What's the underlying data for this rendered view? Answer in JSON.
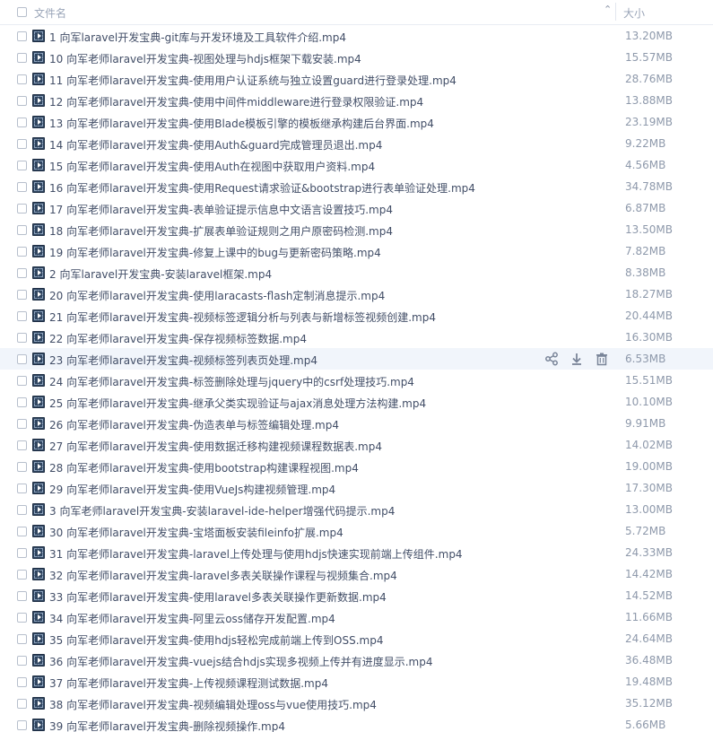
{
  "header": {
    "name_label": "文件名",
    "size_label": "大小",
    "sort_icon": "chevron-up-icon"
  },
  "hover_row_index": 15,
  "hover_actions": [
    "share-icon",
    "download-icon",
    "delete-icon"
  ],
  "files": [
    {
      "name": "1 向军laravel开发宝典-git库与开发环境及工具软件介绍.mp4",
      "size": "13.20MB"
    },
    {
      "name": "10 向军老师laravel开发宝典-视图处理与hdjs框架下载安装.mp4",
      "size": "15.57MB"
    },
    {
      "name": "11 向军老师laravel开发宝典-使用用户认证系统与独立设置guard进行登录处理.mp4",
      "size": "28.76MB"
    },
    {
      "name": "12 向军老师laravel开发宝典-使用中间件middleware进行登录权限验证.mp4",
      "size": "13.88MB"
    },
    {
      "name": "13 向军老师laravel开发宝典-使用Blade模板引擎的模板继承构建后台界面.mp4",
      "size": "23.19MB"
    },
    {
      "name": "14 向军老师laravel开发宝典-使用Auth&guard完成管理员退出.mp4",
      "size": "9.22MB"
    },
    {
      "name": "15 向军老师laravel开发宝典-使用Auth在视图中获取用户资料.mp4",
      "size": "4.56MB"
    },
    {
      "name": "16 向军老师laravel开发宝典-使用Request请求验证&bootstrap进行表单验证处理.mp4",
      "size": "34.78MB"
    },
    {
      "name": "17 向军老师laravel开发宝典-表单验证提示信息中文语言设置技巧.mp4",
      "size": "6.87MB"
    },
    {
      "name": "18 向军老师laravel开发宝典-扩展表单验证规则之用户原密码检测.mp4",
      "size": "13.50MB"
    },
    {
      "name": "19 向军老师laravel开发宝典-修复上课中的bug与更新密码策略.mp4",
      "size": "7.82MB"
    },
    {
      "name": "2 向军laravel开发宝典-安装laravel框架.mp4",
      "size": "8.38MB"
    },
    {
      "name": "20 向军老师laravel开发宝典-使用laracasts-flash定制消息提示.mp4",
      "size": "18.27MB"
    },
    {
      "name": "21 向军老师laravel开发宝典-视频标签逻辑分析与列表与新增标签视频创建.mp4",
      "size": "20.44MB"
    },
    {
      "name": "22 向军老师laravel开发宝典-保存视频标签数据.mp4",
      "size": "16.30MB"
    },
    {
      "name": "23 向军老师laravel开发宝典-视频标签列表页处理.mp4",
      "size": "6.53MB"
    },
    {
      "name": "24 向军老师laravel开发宝典-标签删除处理与jquery中的csrf处理技巧.mp4",
      "size": "15.51MB"
    },
    {
      "name": "25 向军老师laravel开发宝典-继承父类实现验证与ajax消息处理方法构建.mp4",
      "size": "10.10MB"
    },
    {
      "name": "26 向军老师laravel开发宝典-伪造表单与标签编辑处理.mp4",
      "size": "9.91MB"
    },
    {
      "name": "27 向军老师laravel开发宝典-使用数据迁移构建视频课程数据表.mp4",
      "size": "14.02MB"
    },
    {
      "name": "28 向军老师laravel开发宝典-使用bootstrap构建课程视图.mp4",
      "size": "19.00MB"
    },
    {
      "name": "29 向军老师laravel开发宝典-使用VueJs构建视频管理.mp4",
      "size": "17.30MB"
    },
    {
      "name": "3 向军老师laravel开发宝典-安装laravel-ide-helper增强代码提示.mp4",
      "size": "13.00MB"
    },
    {
      "name": "30 向军老师laravel开发宝典-宝塔面板安装fileinfo扩展.mp4",
      "size": "5.72MB"
    },
    {
      "name": "31 向军老师laravel开发宝典-laravel上传处理与使用hdjs快速实现前端上传组件.mp4",
      "size": "24.33MB"
    },
    {
      "name": "32 向军老师laravel开发宝典-laravel多表关联操作课程与视频集合.mp4",
      "size": "14.42MB"
    },
    {
      "name": "33 向军老师laravel开发宝典-使用laravel多表关联操作更新数据.mp4",
      "size": "14.52MB"
    },
    {
      "name": "34 向军老师laravel开发宝典-阿里云oss储存开发配置.mp4",
      "size": "11.66MB"
    },
    {
      "name": "35 向军老师laravel开发宝典-使用hdjs轻松完成前端上传到OSS.mp4",
      "size": "24.64MB"
    },
    {
      "name": "36 向军老师laravel开发宝典-vuejs结合hdjs实现多视频上传并有进度显示.mp4",
      "size": "36.48MB"
    },
    {
      "name": "37 向军老师laravel开发宝典-上传视频课程测试数据.mp4",
      "size": "19.48MB"
    },
    {
      "name": "38 向军老师laravel开发宝典-视频编辑处理oss与vue使用技巧.mp4",
      "size": "35.12MB"
    },
    {
      "name": "39 向军老师laravel开发宝典-删除视频操作.mp4",
      "size": "5.66MB"
    }
  ]
}
